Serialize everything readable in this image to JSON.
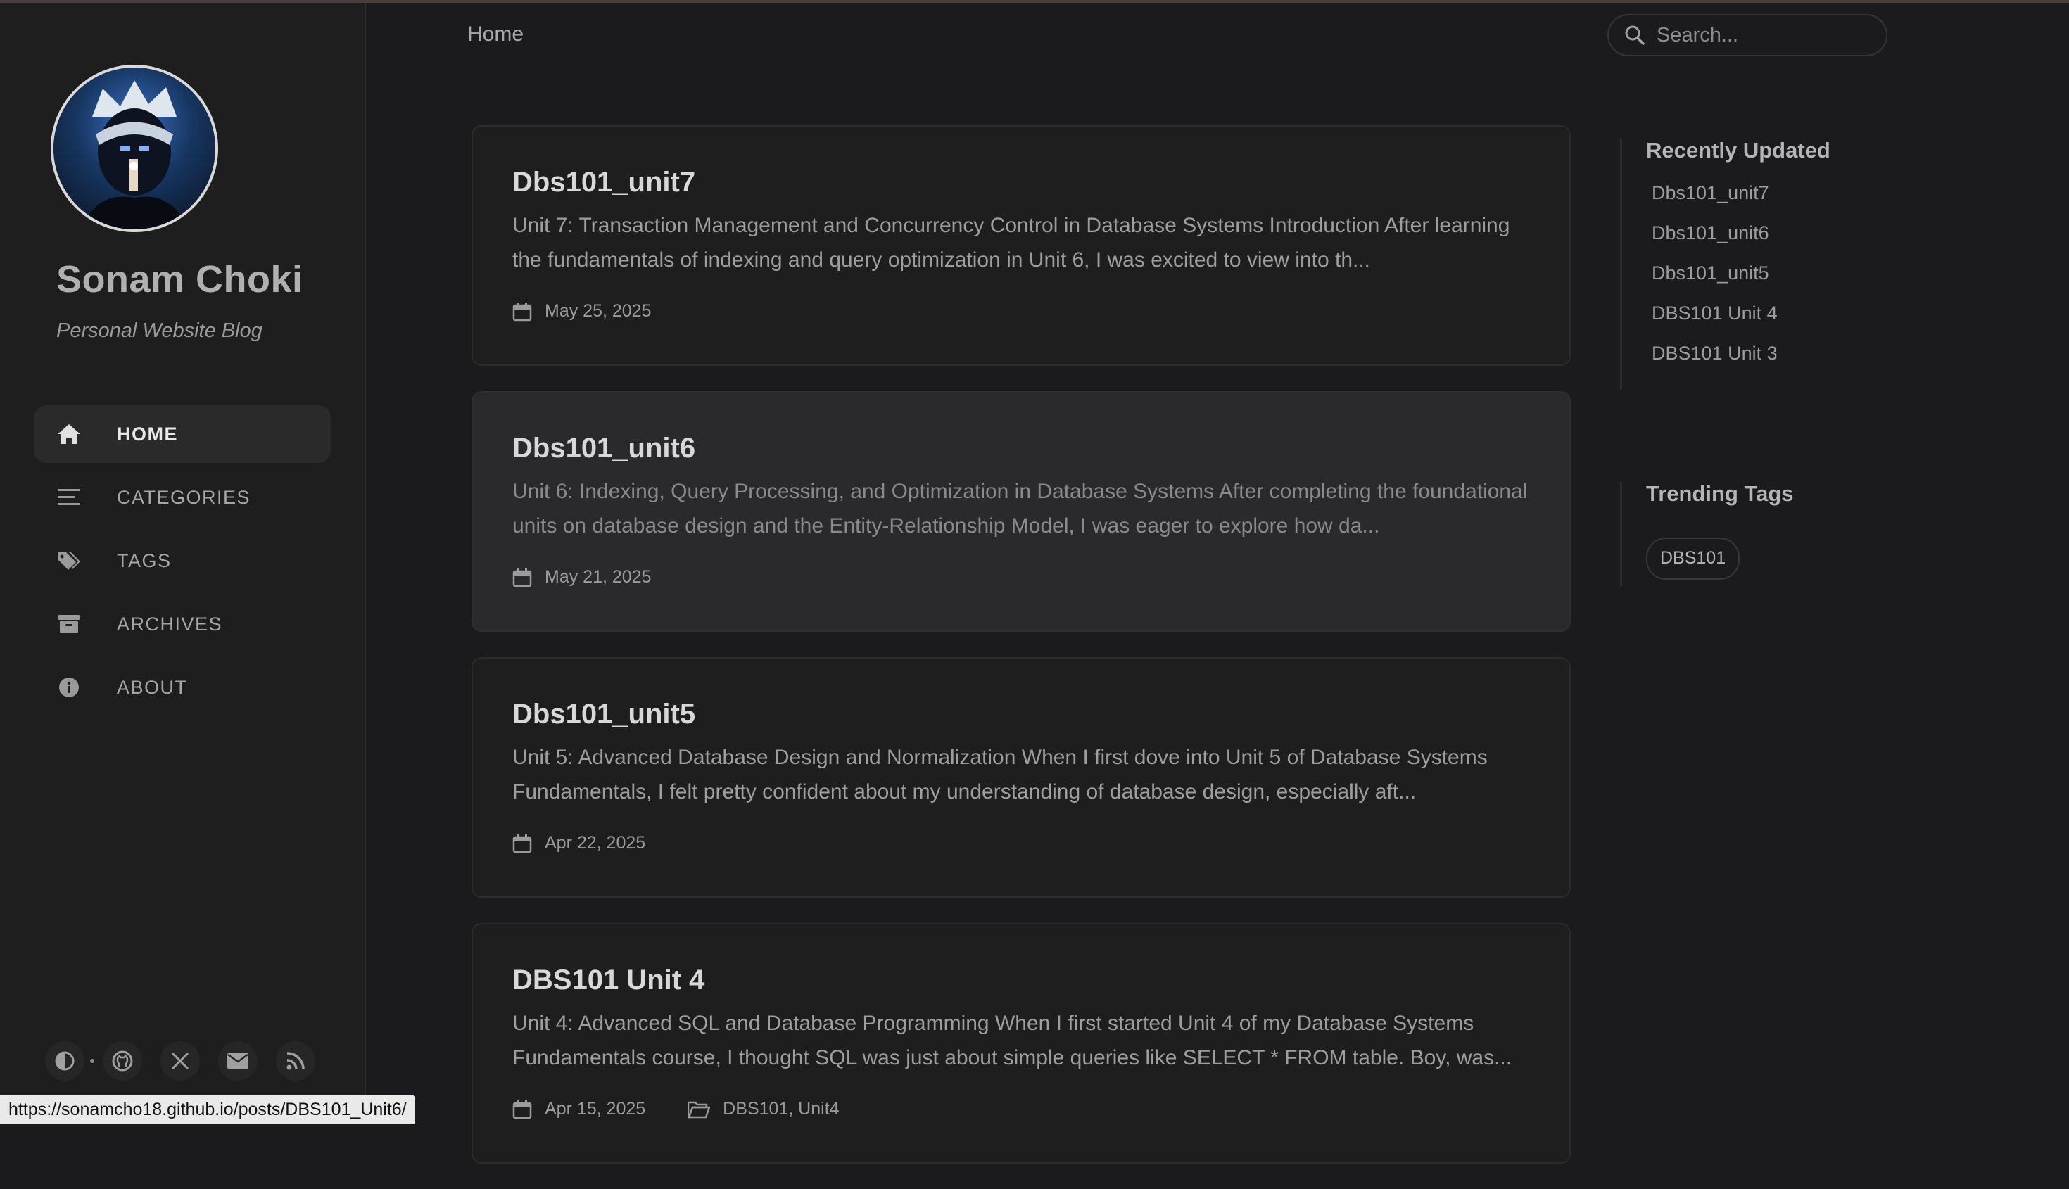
{
  "site": {
    "title": "Sonam Choki",
    "subtitle": "Personal Website Blog"
  },
  "nav": [
    {
      "label": "HOME",
      "icon": "home-icon",
      "active": true
    },
    {
      "label": "CATEGORIES",
      "icon": "stream-icon",
      "active": false
    },
    {
      "label": "TAGS",
      "icon": "tags-icon",
      "active": false
    },
    {
      "label": "ARCHIVES",
      "icon": "archive-icon",
      "active": false
    },
    {
      "label": "ABOUT",
      "icon": "info-circle-icon",
      "active": false
    }
  ],
  "sidebar_bottom": [
    "theme-toggle-icon",
    "github-icon",
    "x-twitter-icon",
    "email-icon",
    "rss-icon"
  ],
  "topbar": {
    "breadcrumb": "Home",
    "search_placeholder": "Search..."
  },
  "posts": [
    {
      "title": "Dbs101_unit7",
      "excerpt": "Unit 7: Transaction Management and Concurrency Control in Database Systems Introduction After learning the fundamentals of indexing and query optimization in Unit 6, I was excited to view into th...",
      "date": "May 25, 2025",
      "category": ""
    },
    {
      "title": "Dbs101_unit6",
      "excerpt": "Unit 6: Indexing, Query Processing, and Optimization in Database Systems After completing the foundational units on database design and the Entity-Relationship Model, I was eager to explore how da...",
      "date": "May 21, 2025",
      "category": ""
    },
    {
      "title": "Dbs101_unit5",
      "excerpt": "Unit 5: Advanced Database Design and Normalization When I first dove into Unit 5 of Database Systems Fundamentals, I felt pretty confident about my understanding of database design, especially aft...",
      "date": "Apr 22, 2025",
      "category": ""
    },
    {
      "title": "DBS101 Unit 4",
      "excerpt": "Unit 4: Advanced SQL and Database Programming When I first started Unit 4 of my Database Systems Fundamentals course, I thought SQL was just about simple queries like SELECT * FROM table. Boy, was...",
      "date": "Apr 15, 2025",
      "category": "DBS101, Unit4"
    }
  ],
  "recently_updated": {
    "heading": "Recently Updated",
    "items": [
      "Dbs101_unit7",
      "Dbs101_unit6",
      "Dbs101_unit5",
      "DBS101 Unit 4",
      "DBS101 Unit 3"
    ]
  },
  "trending_tags": {
    "heading": "Trending Tags",
    "tags": [
      "DBS101"
    ]
  },
  "status_bar": {
    "url": "https://sonamcho18.github.io/posts/DBS101_Unit6/"
  }
}
